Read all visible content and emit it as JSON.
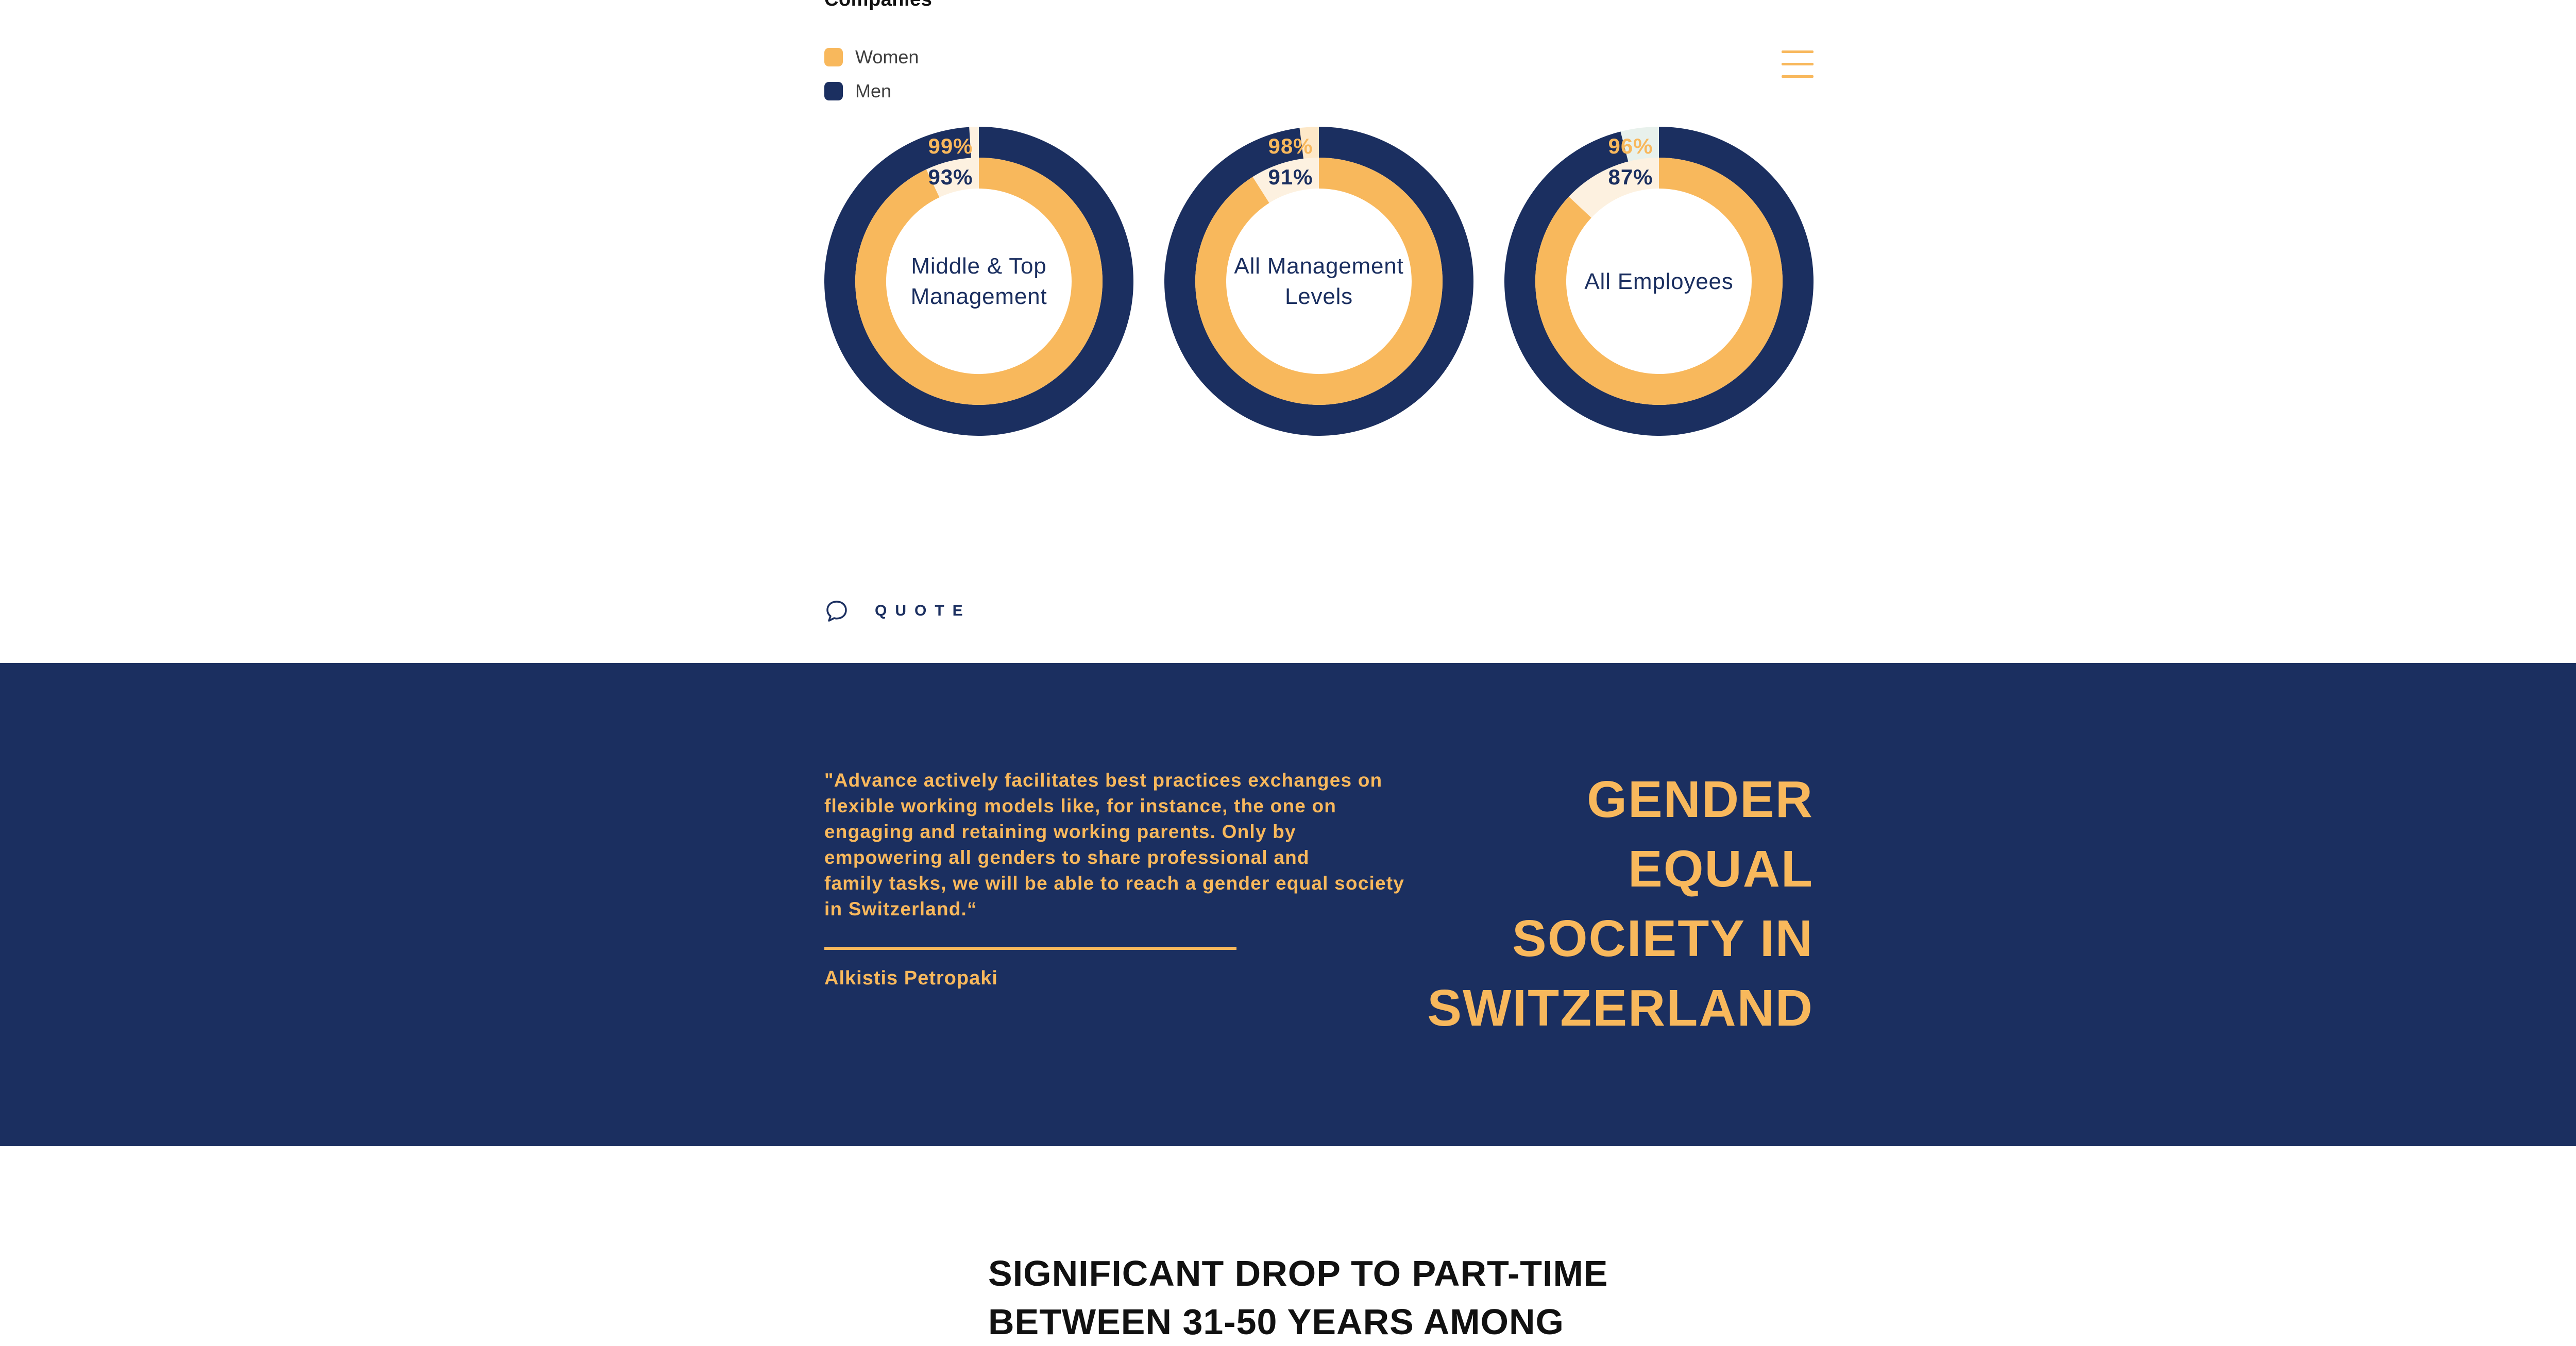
{
  "header": {
    "title": "Companies",
    "menu_icon": "hamburger-menu-icon"
  },
  "legend": [
    {
      "label": "Women",
      "color": "#f8b85c"
    },
    {
      "label": "Men",
      "color": "#1b2f60"
    }
  ],
  "colors": {
    "navy": "#1b2f60",
    "gold": "#f8b85c",
    "gold_light": "#fde8c8",
    "cream": "#fdf1e0",
    "mint_light": "#e8f1ec"
  },
  "chart_data": {
    "type": "donut",
    "series": [
      {
        "name": "Men"
      },
      {
        "name": "Women"
      }
    ],
    "charts": [
      {
        "label": "Middle & Top Management",
        "outer_men_pct": 99,
        "inner_women_pct": 93
      },
      {
        "label": "All Management Levels",
        "outer_men_pct": 98,
        "inner_women_pct": 91
      },
      {
        "label": "All Employees",
        "outer_men_pct": 96,
        "inner_women_pct": 87
      }
    ]
  },
  "quote_section": {
    "tag": "QUOTE",
    "icon": "speech-bubble-icon",
    "text": "\"Advance actively facilitates best practices exchanges on\nflexible working models like, for instance, the one on\nengaging and retaining working parents. Only by\nempowering all genders to share professional and\nfamily tasks, we will be able to reach a gender equal society\nin Switzerland.“",
    "author": "Alkistis Petropaki",
    "heading": "GENDER\nEQUAL\nSOCIETY IN\nSWITZERLAND"
  },
  "next_section": {
    "heading": "SIGNIFICANT DROP TO PART-TIME\nBETWEEN 31-50 YEARS AMONG"
  }
}
